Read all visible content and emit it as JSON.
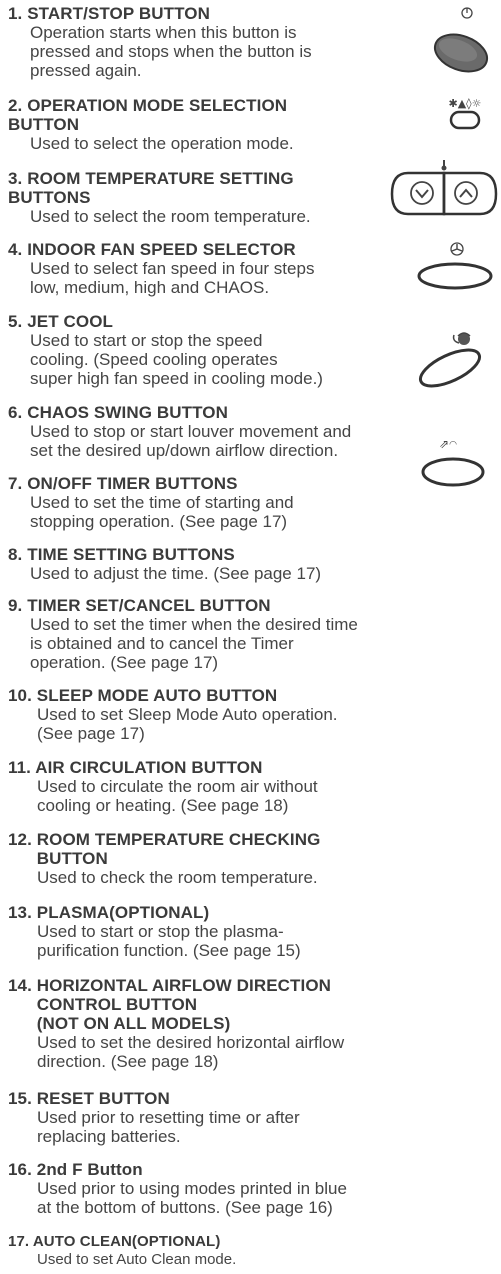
{
  "items": [
    {
      "num": "1.",
      "title": "START/STOP BUTTON",
      "desc": "Operation starts when this button is\npressed and stops when the button is\npressed again."
    },
    {
      "num": "2.",
      "title": "OPERATION MODE SELECTION\nBUTTON",
      "desc": "Used to select the operation mode."
    },
    {
      "num": "3.",
      "title": "ROOM TEMPERATURE SETTING\nBUTTONS",
      "desc": "Used to select the room temperature."
    },
    {
      "num": "4.",
      "title": "INDOOR FAN SPEED SELECTOR",
      "desc": "Used to select fan speed in four steps\nlow, medium, high and CHAOS."
    },
    {
      "num": "5.",
      "title": "JET COOL",
      "desc": "Used to start or stop the speed\ncooling. (Speed cooling operates\nsuper high fan speed in cooling mode.)"
    },
    {
      "num": "6.",
      "title": "CHAOS SWING BUTTON",
      "desc": "Used to stop or start louver movement and\nset the desired up/down airflow direction."
    },
    {
      "num": "7.",
      "title": "ON/OFF TIMER BUTTONS",
      "desc": "Used to set the time of starting and\nstopping operation. (See page 17)"
    },
    {
      "num": "8.",
      "title": "TIME SETTING BUTTONS",
      "desc": "Used to adjust the time. (See page 17)"
    },
    {
      "num": "9.",
      "title": "TIMER SET/CANCEL BUTTON",
      "desc": "Used to set the timer when the desired time\nis obtained and to cancel the Timer\noperation. (See page 17)"
    },
    {
      "num": "10.",
      "title": "SLEEP MODE AUTO BUTTON",
      "desc": "Used to set Sleep Mode Auto operation.\n(See page 17)"
    },
    {
      "num": "11.",
      "title": "AIR CIRCULATION BUTTON",
      "desc": "Used to circulate the room air without\ncooling or heating. (See page 18)"
    },
    {
      "num": "12.",
      "title": "ROOM TEMPERATURE CHECKING\nBUTTON",
      "desc": "Used to check the room temperature."
    },
    {
      "num": "13.",
      "title": "PLASMA(OPTIONAL)",
      "desc": "Used to start or stop the plasma-\npurification function. (See page 15)"
    },
    {
      "num": "14.",
      "title": "HORIZONTAL AIRFLOW DIRECTION\nCONTROL BUTTON\n(NOT ON ALL MODELS)",
      "desc": "Used to set the desired horizontal airflow\ndirection. (See page 18)"
    },
    {
      "num": "15.",
      "title": "RESET BUTTON",
      "desc": "Used prior to resetting time or after\nreplacing batteries."
    },
    {
      "num": "16.",
      "title": "2nd F Button",
      "desc": "Used prior to using modes printed in blue\nat the bottom of buttons. (See page 16)"
    },
    {
      "num": "17.",
      "title": "AUTO CLEAN(OPTIONAL)",
      "desc": "Used to set Auto Clean mode."
    }
  ],
  "icons": {
    "start_stop": "power-icon",
    "mode": "mode-symbols-icon",
    "temp": "temperature-arrows-icon",
    "fan": "fan-icon",
    "jet": "jet-cool-icon",
    "swing": "swing-icon"
  }
}
